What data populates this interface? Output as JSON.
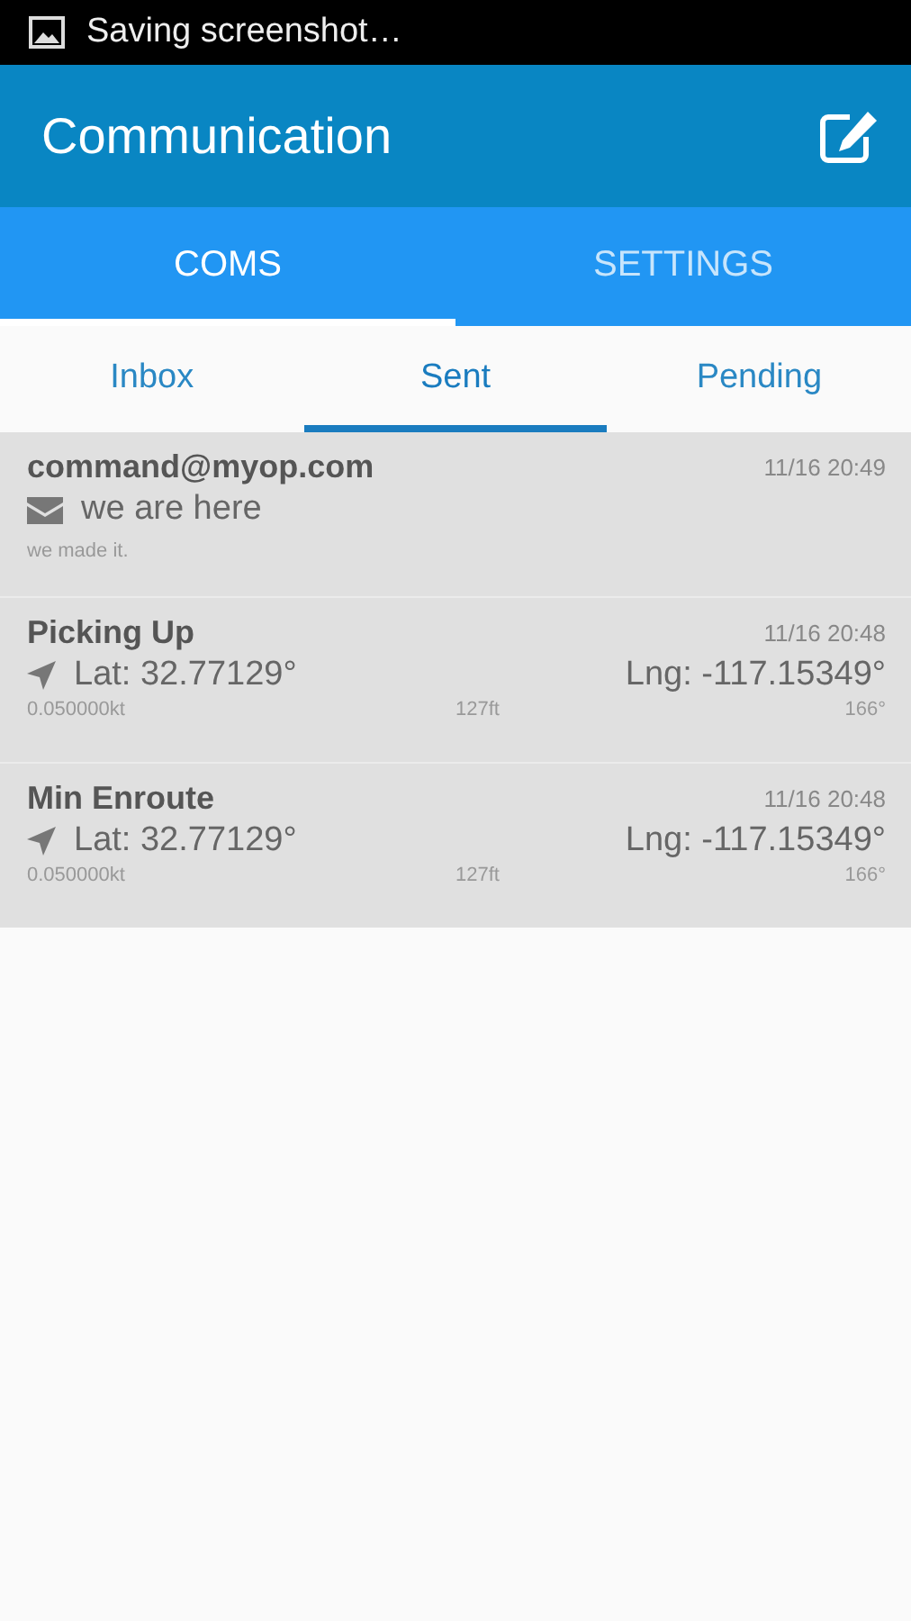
{
  "status_bar": {
    "notification": "Saving screenshot…"
  },
  "app_bar": {
    "title": "Communication"
  },
  "tabs": [
    {
      "label": "COMS",
      "selected": true
    },
    {
      "label": "SETTINGS",
      "selected": false
    }
  ],
  "subtabs": [
    {
      "label": "Inbox",
      "selected": false
    },
    {
      "label": "Sent",
      "selected": true
    },
    {
      "label": "Pending",
      "selected": false
    }
  ],
  "messages": [
    {
      "kind": "message",
      "title": "command@myop.com",
      "time": "11/16 20:49",
      "subject": "we are here",
      "body": "we made it."
    },
    {
      "kind": "location",
      "title": "Picking Up",
      "time": "11/16 20:48",
      "lat": "Lat: 32.77129°",
      "lng": "Lng: -117.15349°",
      "speed": "0.050000kt",
      "altitude": "127ft",
      "heading": "166°"
    },
    {
      "kind": "location",
      "title": "Min Enroute",
      "time": "11/16 20:48",
      "lat": "Lat: 32.77129°",
      "lng": "Lng: -117.15349°",
      "speed": "0.050000kt",
      "altitude": "127ft",
      "heading": "166°"
    }
  ]
}
